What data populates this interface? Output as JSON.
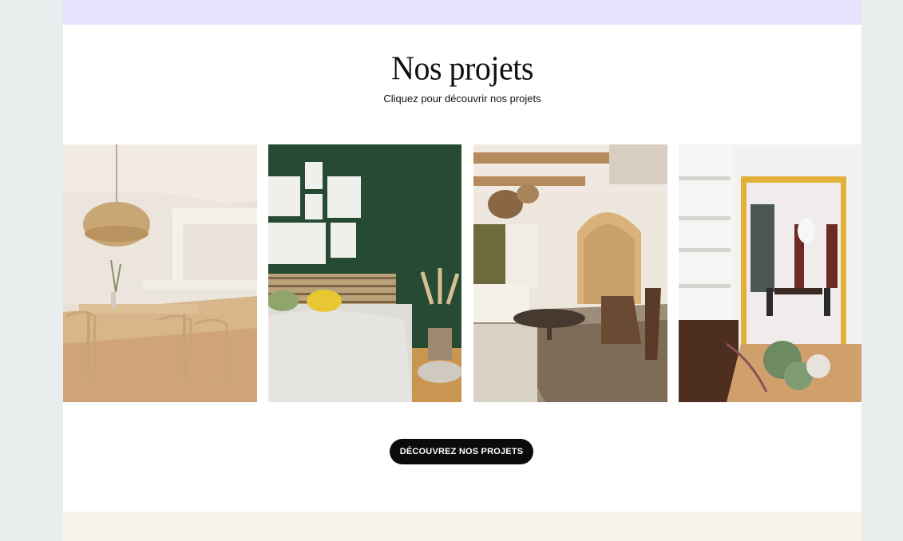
{
  "section": {
    "title": "Nos projets",
    "subtitle": "Cliquez pour découvrir nos projets"
  },
  "projects": [
    {
      "image": "dining-room-photo"
    },
    {
      "image": "bedroom-green-wall-photo"
    },
    {
      "image": "living-room-arch-photo"
    },
    {
      "image": "hallway-dining-photo"
    }
  ],
  "cta": {
    "label": "DÉCOUVREZ NOS PROJETS"
  },
  "colors": {
    "background": "#e9edee",
    "top_band": "#e6e4fd",
    "bottom_band": "#f6f3ea",
    "button": "#0b0b0b"
  }
}
